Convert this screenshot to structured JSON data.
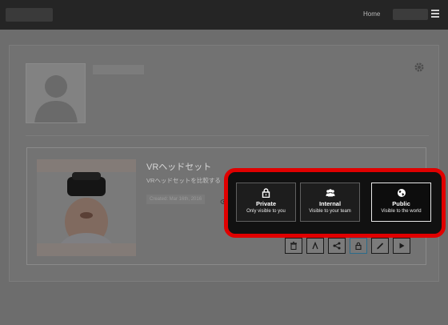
{
  "header": {
    "nav_home": "Home"
  },
  "card": {
    "title": "VRヘッドセット",
    "description": "VRヘッドセットを比較する",
    "created": "Created: Mar 16th, 2016"
  },
  "visibility": {
    "options": [
      {
        "label": "Private",
        "sub": "Only visible to you",
        "icon": "lock-icon"
      },
      {
        "label": "Internal",
        "sub": "Visible to your team",
        "icon": "team-icon"
      },
      {
        "label": "Public",
        "sub": "Visible to the world",
        "icon": "globe-icon"
      }
    ],
    "selected": "Public"
  },
  "colors": {
    "highlight": "#e00000",
    "topbar": "#252525",
    "overlay": "#6d6d6d"
  }
}
